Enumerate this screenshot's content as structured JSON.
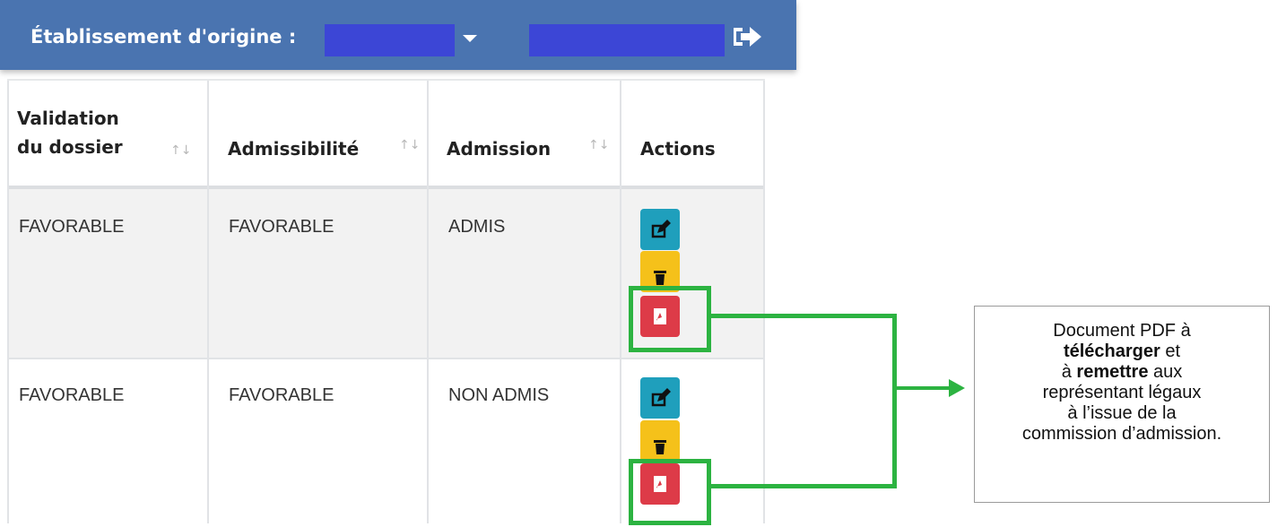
{
  "header": {
    "title": "Établissement d'origine :",
    "redaction_color": "#3c46d6",
    "icons": [
      "caret-down-icon",
      "logout-icon"
    ]
  },
  "table": {
    "columns": [
      {
        "line1": "Validation",
        "line2": "du dossier",
        "sortable": true
      },
      {
        "line1": "",
        "line2": "Admissibilité",
        "sortable": true
      },
      {
        "line1": "",
        "line2": "Admission",
        "sortable": true
      },
      {
        "line1": "",
        "line2": "Actions",
        "sortable": false
      }
    ],
    "sort_glyph": "↑↓",
    "rows": [
      {
        "validation": "FAVORABLE",
        "admissibilite": "FAVORABLE",
        "admission": "ADMIS",
        "actions": [
          "edit-icon",
          "trash-icon",
          "pdf-icon"
        ]
      },
      {
        "validation": "FAVORABLE",
        "admissibilite": "FAVORABLE",
        "admission": "NON ADMIS",
        "actions": [
          "edit-icon",
          "trash-icon",
          "pdf-icon"
        ]
      }
    ]
  },
  "callout": {
    "line1": "Document PDF à",
    "line2_bold": "télécharger",
    "line2_rest": " et",
    "line3_pre": "à ",
    "line3_bold": "remettre",
    "line3_rest": " aux",
    "line4": "représentant légaux",
    "line5": "à l’issue de la",
    "line6": "commission d’admission."
  },
  "colors": {
    "header_bg": "#4a74b0",
    "edit_button": "#1f9fbc",
    "delete_button": "#f5c11a",
    "pdf_button": "#dd3b48",
    "highlight": "#2cb341"
  }
}
